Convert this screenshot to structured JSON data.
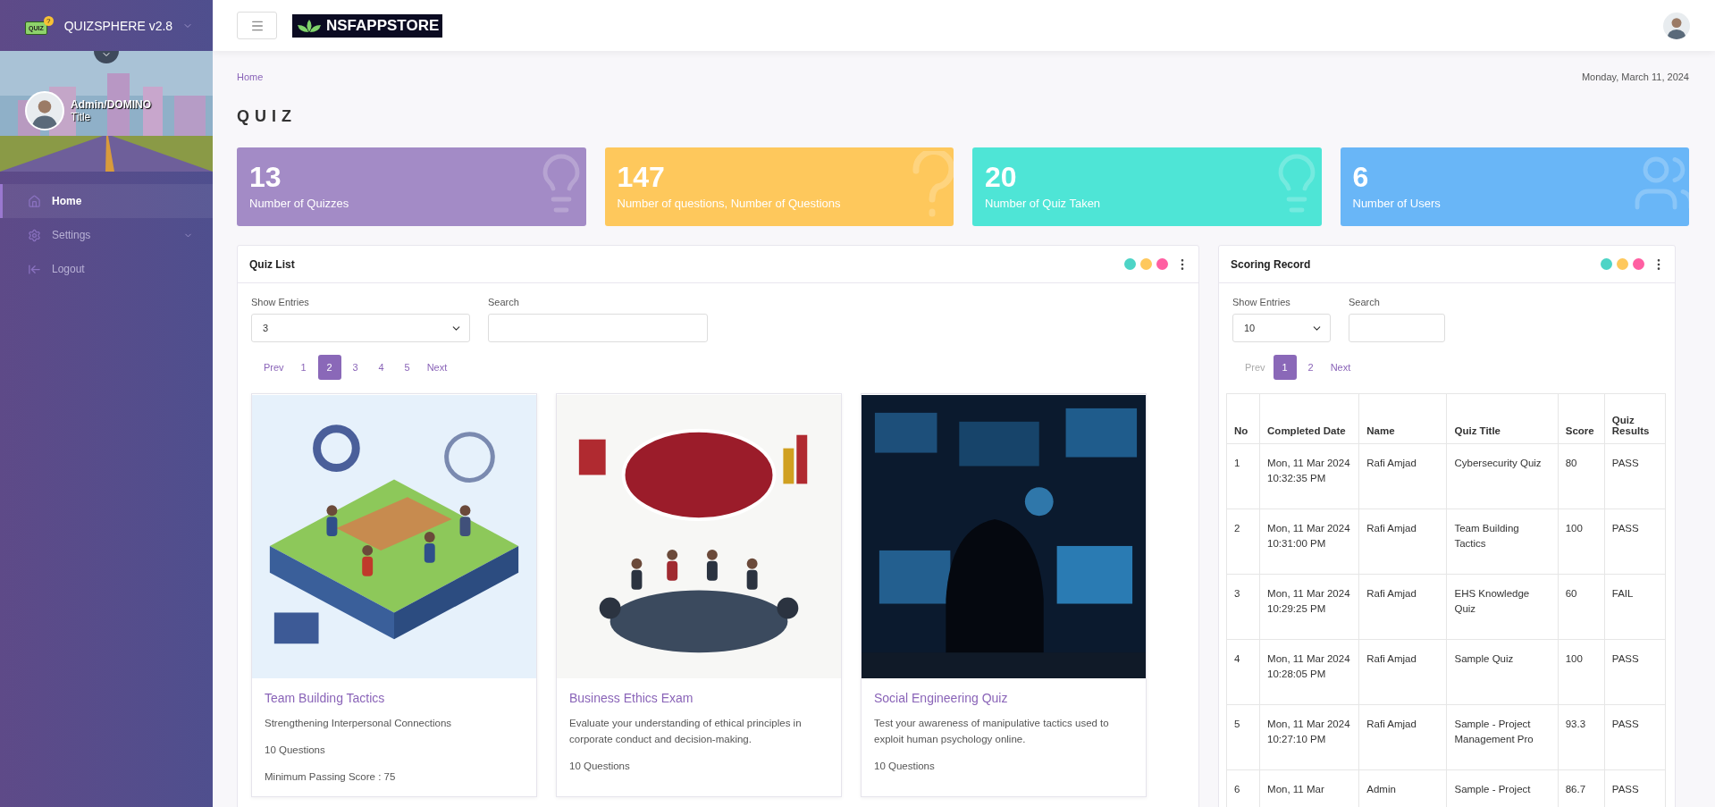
{
  "sidebar": {
    "brand_badge": "QUIZ",
    "brand_mark": "?",
    "brand": "QUIZSPHERE v2.8",
    "user": {
      "name": "Admin/DOMINO",
      "title": "Title"
    },
    "items": [
      {
        "kind": "home",
        "label": "Home",
        "selected": true,
        "expandable": false
      },
      {
        "kind": "settings",
        "label": "Settings",
        "selected": false,
        "expandable": true
      },
      {
        "kind": "logout",
        "label": "Logout",
        "selected": false,
        "expandable": false
      }
    ]
  },
  "header": {
    "logo": "NSFAPPSTORE"
  },
  "breadcrumb": "Home",
  "date": "Monday, March 11, 2024",
  "page_title": "QUIZ",
  "stats": [
    {
      "kind": "idea",
      "value": "13",
      "label": "Number of Quizzes",
      "color": "#a38bc6"
    },
    {
      "kind": "question",
      "value": "147",
      "label": "Number of questions, Number of Questions",
      "color": "#fec85c"
    },
    {
      "kind": "idea",
      "value": "20",
      "label": "Number of Quiz Taken",
      "color": "#4ee5d6"
    },
    {
      "kind": "users",
      "value": "6",
      "label": "Number of Users",
      "color": "#69b6f7"
    }
  ],
  "quiz_list": {
    "title": "Quiz List",
    "dots": [
      {
        "color": "#4dd4c6"
      },
      {
        "color": "#fec85c"
      },
      {
        "color": "#ff5fa2"
      }
    ],
    "show_entries_label": "Show Entries",
    "show_entries_value": "3",
    "search_label": "Search",
    "pagination": [
      {
        "label": "Prev",
        "selected": false,
        "disabled": false
      },
      {
        "label": "1",
        "selected": false,
        "disabled": false
      },
      {
        "label": "2",
        "selected": true,
        "disabled": false
      },
      {
        "label": "3",
        "selected": false,
        "disabled": false
      },
      {
        "label": "4",
        "selected": false,
        "disabled": false
      },
      {
        "label": "5",
        "selected": false,
        "disabled": false
      },
      {
        "label": "Next",
        "selected": false,
        "disabled": false
      }
    ],
    "quizzes": [
      {
        "kind": "picture",
        "title": "Team Building Tactics",
        "description": "Strengthening Interpersonal Connections",
        "questions": "10 Questions",
        "passing": "Minimum Passing Score : 75"
      },
      {
        "kind": "picture",
        "title": "Business Ethics Exam",
        "description": "Evaluate your understanding of ethical principles in corporate conduct and decision-making.",
        "questions": "10 Questions"
      },
      {
        "kind": "picture",
        "title": "Social Engineering Quiz",
        "description": "Test your awareness of manipulative tactics used to exploit human psychology online.",
        "questions": "10 Questions"
      }
    ]
  },
  "scoring_record": {
    "title": "Scoring Record",
    "dots": [
      {
        "color": "#4dd4c6"
      },
      {
        "color": "#fec85c"
      },
      {
        "color": "#ff5fa2"
      }
    ],
    "show_entries_label": "Show Entries",
    "show_entries_value": "10",
    "search_label": "Search",
    "pagination": [
      {
        "label": "Prev",
        "selected": false,
        "disabled": true
      },
      {
        "label": "1",
        "selected": true,
        "disabled": false
      },
      {
        "label": "2",
        "selected": false,
        "disabled": false
      },
      {
        "label": "Next",
        "selected": false,
        "disabled": false
      }
    ],
    "columns": [
      "No",
      "Completed Date",
      "Name",
      "Quiz Title",
      "Score",
      "Quiz Results"
    ],
    "rows": [
      [
        "1",
        "Mon, 11 Mar 2024 10:32:35 PM",
        "Rafi Amjad",
        "Cybersecurity Quiz",
        "80",
        "PASS"
      ],
      [
        "2",
        "Mon, 11 Mar 2024 10:31:00 PM",
        "Rafi Amjad",
        "Team Building Tactics",
        "100",
        "PASS"
      ],
      [
        "3",
        "Mon, 11 Mar 2024 10:29:25 PM",
        "Rafi Amjad",
        "EHS Knowledge Quiz",
        "60",
        "FAIL"
      ],
      [
        "4",
        "Mon, 11 Mar 2024 10:28:05 PM",
        "Rafi Amjad",
        "Sample Quiz",
        "100",
        "PASS"
      ],
      [
        "5",
        "Mon, 11 Mar 2024 10:27:10 PM",
        "Rafi Amjad",
        "Sample - Project Management Pro",
        "93.3",
        "PASS"
      ],
      [
        "6",
        "Mon, 11 Mar",
        "Admin",
        "Sample - Project",
        "86.7",
        "PASS"
      ]
    ]
  }
}
